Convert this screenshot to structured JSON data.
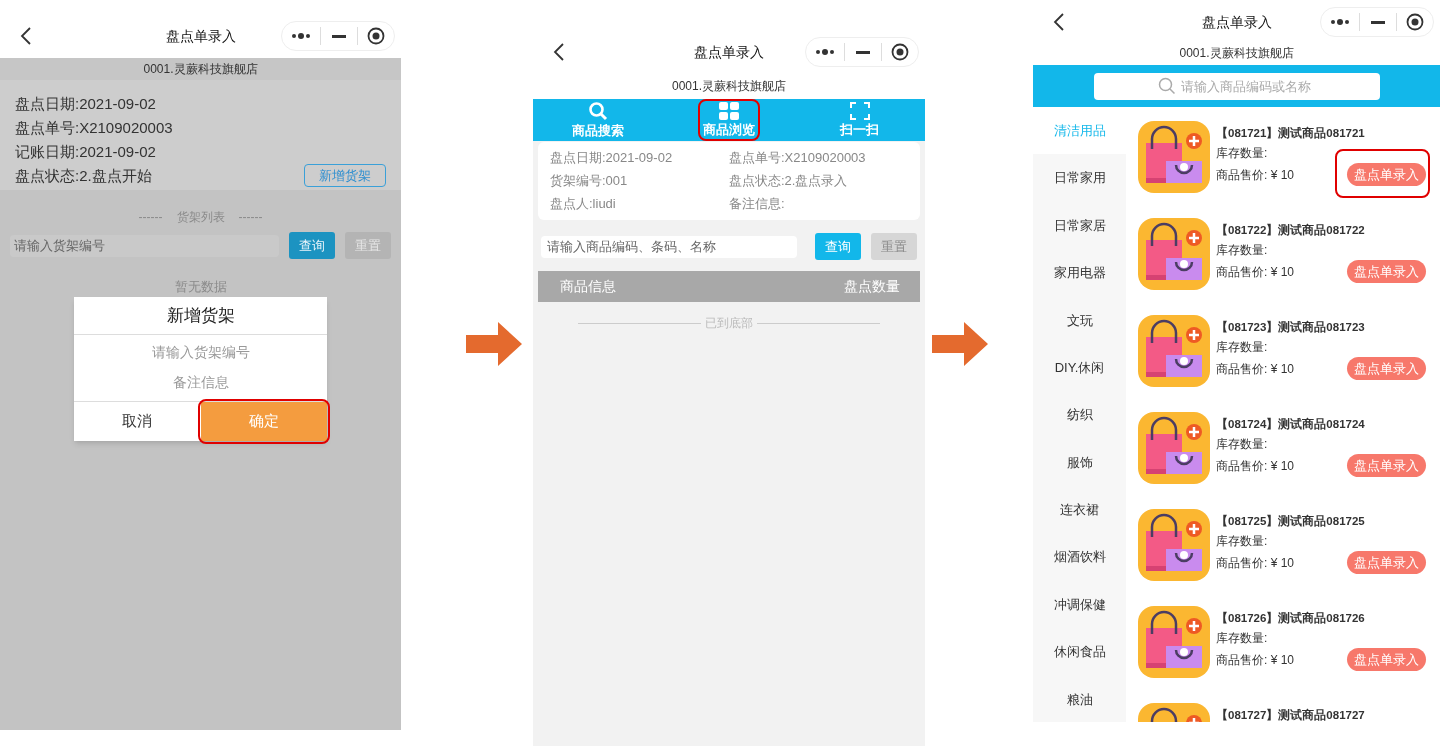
{
  "screens": [
    {
      "kind": "shelf_dialog",
      "title": "盘点单录入",
      "store": "0001.灵蕨科技旗舰店",
      "info": [
        "盘点日期:2021-09-02",
        "盘点单号:X2109020003",
        "记账日期:2021-09-02",
        "盘点状态:2.盘点开始"
      ],
      "add_button": "新增货架",
      "list_title": "货架列表",
      "list_dashes": "------",
      "search": {
        "placeholder": "请输入货架编号"
      },
      "query_button": "查询",
      "reset_button": "重置",
      "empty_text": "暂无数据",
      "dialog": {
        "title": "新增货架",
        "fields": [
          {
            "placeholder": "请输入货架编号"
          },
          {
            "placeholder": "备注信息"
          }
        ],
        "buttons": [
          {
            "label": "取消",
            "kind": "cancel",
            "highlighted": false
          },
          {
            "label": "确定",
            "kind": "confirm",
            "highlighted": true
          }
        ]
      }
    },
    {
      "kind": "shelf_detail",
      "title": "盘点单录入",
      "store": "0001.灵蕨科技旗舰店",
      "tabs": [
        {
          "label": "商品搜索",
          "kind": "search",
          "highlighted": false
        },
        {
          "label": "商品浏览",
          "kind": "grid",
          "highlighted": true
        },
        {
          "label": "扫一扫",
          "kind": "scan",
          "highlighted": false
        }
      ],
      "info": [
        "盘点日期:2021-09-02",
        "盘点单号:X2109020003",
        "货架编号:001",
        "盘点状态:2.盘点录入",
        "盘点人:liudi",
        "备注信息:"
      ],
      "search": {
        "placeholder": "请输入商品编码、条码、名称"
      },
      "query_button": "查询",
      "reset_button": "重置",
      "columns": [
        "商品信息",
        "盘点数量"
      ],
      "end_text": "已到底部"
    },
    {
      "kind": "product_browse",
      "title": "盘点单录入",
      "store": "0001.灵蕨科技旗舰店",
      "search": {
        "placeholder": "请输入商品编码或名称"
      },
      "categories": [
        {
          "label": "清洁用品",
          "selected": true
        },
        {
          "label": "日常家用",
          "selected": false
        },
        {
          "label": "日常家居",
          "selected": false
        },
        {
          "label": "家用电器",
          "selected": false
        },
        {
          "label": "文玩",
          "selected": false
        },
        {
          "label": "DIY.休闲",
          "selected": false
        },
        {
          "label": "纺织",
          "selected": false
        },
        {
          "label": "服饰",
          "selected": false
        },
        {
          "label": "连衣裙",
          "selected": false
        },
        {
          "label": "烟酒饮料",
          "selected": false
        },
        {
          "label": "冲调保健",
          "selected": false
        },
        {
          "label": "休闲食品",
          "selected": false
        },
        {
          "label": "粮油",
          "selected": false
        }
      ],
      "products": [
        {
          "name": "【081721】测试商品081721",
          "stock": "库存数量:",
          "price": "商品售价: ¥ 10",
          "button": "盘点单录入",
          "highlighted": true
        },
        {
          "name": "【081722】测试商品081722",
          "stock": "库存数量:",
          "price": "商品售价: ¥ 10",
          "button": "盘点单录入",
          "highlighted": false
        },
        {
          "name": "【081723】测试商品081723",
          "stock": "库存数量:",
          "price": "商品售价: ¥ 10",
          "button": "盘点单录入",
          "highlighted": false
        },
        {
          "name": "【081724】测试商品081724",
          "stock": "库存数量:",
          "price": "商品售价: ¥ 10",
          "button": "盘点单录入",
          "highlighted": false
        },
        {
          "name": "【081725】测试商品081725",
          "stock": "库存数量:",
          "price": "商品售价: ¥ 10",
          "button": "盘点单录入",
          "highlighted": false
        },
        {
          "name": "【081726】测试商品081726",
          "stock": "库存数量:",
          "price": "商品售价: ¥ 10",
          "button": "盘点单录入",
          "highlighted": false
        },
        {
          "name": "【081727】测试商品081727"
        }
      ]
    }
  ]
}
